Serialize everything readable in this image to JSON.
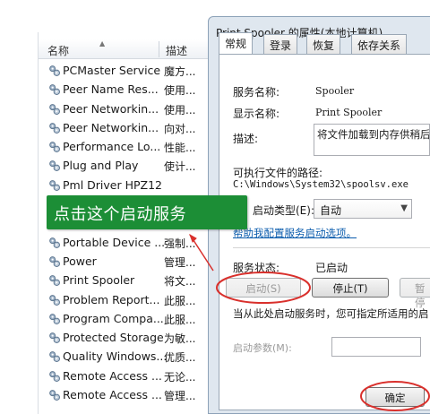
{
  "services_list": {
    "column_name": "名称",
    "column_desc": "描述",
    "rows": [
      {
        "name": "PCMaster Service",
        "desc": "魔方..."
      },
      {
        "name": "Peer Name Res...",
        "desc": "使用..."
      },
      {
        "name": "Peer Networkin...",
        "desc": "使用..."
      },
      {
        "name": "Peer Networkin...",
        "desc": "向对..."
      },
      {
        "name": "Performance Lo...",
        "desc": "性能..."
      },
      {
        "name": "Plug and Play",
        "desc": "使计..."
      },
      {
        "name": "Pml Driver HPZ12",
        "desc": ""
      },
      {
        "name": "",
        "desc": ""
      },
      {
        "name": "",
        "desc": ""
      },
      {
        "name": "Portable Device ...",
        "desc": "强制..."
      },
      {
        "name": "Power",
        "desc": "管理..."
      },
      {
        "name": "Print Spooler",
        "desc": "将文..."
      },
      {
        "name": "Problem Report...",
        "desc": "此服..."
      },
      {
        "name": "Program Compa...",
        "desc": "此服..."
      },
      {
        "name": "Protected Storage",
        "desc": "为敏..."
      },
      {
        "name": "Quality Windows...",
        "desc": "优质..."
      },
      {
        "name": "Remote Access ...",
        "desc": "无论..."
      },
      {
        "name": "Remote Access ...",
        "desc": "管理..."
      }
    ]
  },
  "dialog": {
    "title": "Print Spooler 的属性(本地计算机)",
    "tabs": [
      "常规",
      "登录",
      "恢复",
      "依存关系"
    ],
    "service_name_label": "服务名称:",
    "service_name_value": "Spooler",
    "display_name_label": "显示名称:",
    "display_name_value": "Print Spooler",
    "description_label": "描述:",
    "description_value": "将文件加载到内存供稍后",
    "exe_path_label": "可执行文件的路径:",
    "exe_path_value": "C:\\Windows\\System32\\spoolsv.exe",
    "startup_type_label": "启动类型(E):",
    "startup_type_value": "自动",
    "help_link": "帮助我配置服务启动选项。",
    "status_label": "服务状态:",
    "status_value": "已启动",
    "start_button": "启动(S)",
    "stop_button": "停止(T)",
    "pause_button": "暂停",
    "hint_text": "当从此处启动服务时，您可指定所适用的启",
    "start_params_label": "启动参数(M):",
    "ok_button": "确定"
  },
  "annotation": {
    "callout_text": "点击这个启动服务",
    "accent_color": "#d9302c",
    "callout_color": "#1c8e36"
  }
}
